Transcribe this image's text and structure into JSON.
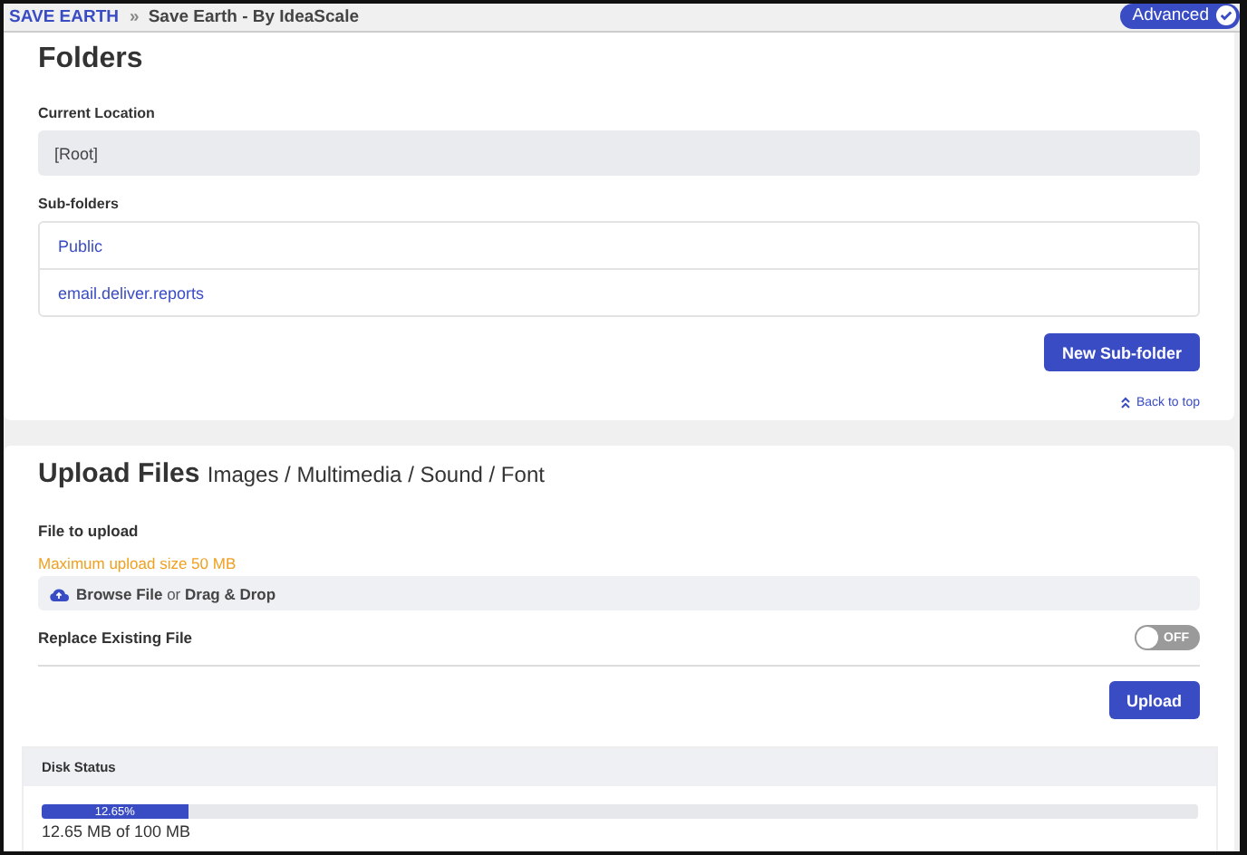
{
  "breadcrumb": {
    "root": "SAVE EARTH",
    "separator": "»",
    "current": "Save Earth - By IdeaScale"
  },
  "mode_badge": {
    "label": "Advanced",
    "checked": true
  },
  "folders": {
    "title": "Folders",
    "location_label": "Current Location",
    "location_value": "[Root]",
    "subfolders_label": "Sub-folders",
    "subfolders": [
      "Public",
      "email.deliver.reports"
    ],
    "new_button": "New Sub-folder",
    "back_to_top": "Back to top"
  },
  "upload": {
    "title": "Upload Files",
    "subtitle": "Images / Multimedia / Sound / Font",
    "file_label": "File to upload",
    "limit_note": "Maximum upload size 50 MB",
    "drop_zone": {
      "browse": "Browse File",
      "or": "or",
      "drag": "Drag & Drop"
    },
    "replace": {
      "label": "Replace Existing File",
      "on": false,
      "state_label": "OFF"
    },
    "upload_button": "Upload"
  },
  "disk_status": {
    "title": "Disk Status",
    "level": 0.1265,
    "percent": "12.65%",
    "usage": "12.65 MB of 100 MB"
  }
}
